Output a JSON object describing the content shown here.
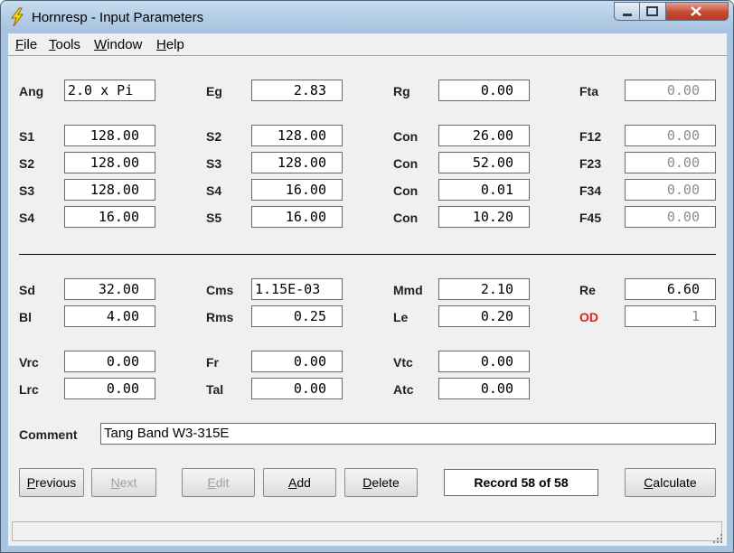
{
  "window": {
    "title": "Hornresp - Input Parameters"
  },
  "menu": [
    "File",
    "Tools",
    "Window",
    "Help"
  ],
  "menu_underline": [
    "F",
    "T",
    "W",
    "H"
  ],
  "fields": {
    "ang": {
      "label": "Ang",
      "value": "2.0 x Pi"
    },
    "eg": {
      "label": "Eg",
      "value": "2.83"
    },
    "rg": {
      "label": "Rg",
      "value": "0.00"
    },
    "fta": {
      "label": "Fta",
      "value": "0.00"
    },
    "r1": {
      "s_label": "S1",
      "s_value": "128.00",
      "s2_label": "S2",
      "s2_value": "128.00",
      "con_label": "Con",
      "con_value": "26.00",
      "f_label": "F12",
      "f_value": "0.00"
    },
    "r2": {
      "s_label": "S2",
      "s_value": "128.00",
      "s2_label": "S3",
      "s2_value": "128.00",
      "con_label": "Con",
      "con_value": "52.00",
      "f_label": "F23",
      "f_value": "0.00"
    },
    "r3": {
      "s_label": "S3",
      "s_value": "128.00",
      "s2_label": "S4",
      "s2_value": "16.00",
      "con_label": "Con",
      "con_value": "0.01",
      "f_label": "F34",
      "f_value": "0.00"
    },
    "r4": {
      "s_label": "S4",
      "s_value": "16.00",
      "s2_label": "S5",
      "s2_value": "16.00",
      "con_label": "Con",
      "con_value": "10.20",
      "f_label": "F45",
      "f_value": "0.00"
    },
    "sd": {
      "label": "Sd",
      "value": "32.00"
    },
    "cms": {
      "label": "Cms",
      "value": "1.15E-03"
    },
    "mmd": {
      "label": "Mmd",
      "value": "2.10"
    },
    "re": {
      "label": "Re",
      "value": "6.60"
    },
    "bl": {
      "label": "Bl",
      "value": "4.00"
    },
    "rms": {
      "label": "Rms",
      "value": "0.25"
    },
    "le": {
      "label": "Le",
      "value": "0.20"
    },
    "od": {
      "label": "OD",
      "value": "1"
    },
    "vrc": {
      "label": "Vrc",
      "value": "0.00"
    },
    "fr": {
      "label": "Fr",
      "value": "0.00"
    },
    "vtc": {
      "label": "Vtc",
      "value": "0.00"
    },
    "lrc": {
      "label": "Lrc",
      "value": "0.00"
    },
    "tal": {
      "label": "Tal",
      "value": "0.00"
    },
    "atc": {
      "label": "Atc",
      "value": "0.00"
    }
  },
  "comment": {
    "label": "Comment",
    "value": "Tang Band W3-315E"
  },
  "buttons": {
    "previous": "Previous",
    "next": "Next",
    "edit": "Edit",
    "add": "Add",
    "delete": "Delete",
    "calculate": "Calculate"
  },
  "record": "Record 58 of 58",
  "colors": {
    "title_bar": "#b4cde6",
    "close_button": "#c94a32",
    "od_label": "#e02020",
    "client_bg": "#f0f0f0"
  }
}
